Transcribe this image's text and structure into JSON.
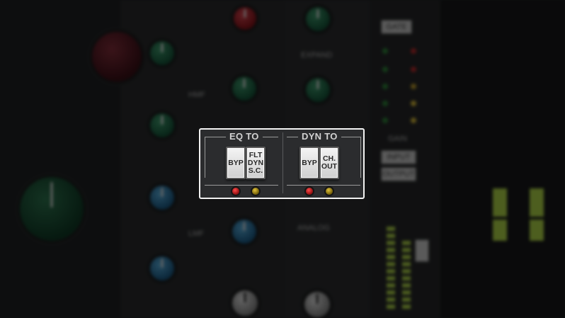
{
  "panel": {
    "eq_to": {
      "title": "EQ TO",
      "buttons": [
        {
          "label": "BYP"
        },
        {
          "lines": [
            "FLT",
            "DYN",
            "S.C."
          ]
        }
      ],
      "leds": [
        "red",
        "yellow"
      ]
    },
    "dyn_to": {
      "title": "DYN TO",
      "buttons": [
        {
          "label": "BYP"
        },
        {
          "lines": [
            "CH.",
            "OUT"
          ]
        }
      ],
      "leds": [
        "red",
        "yellow"
      ]
    }
  },
  "background": {
    "labels": {
      "expand": "EXPAND",
      "hmf": "HMF",
      "lmf": "LMF",
      "gate": "GATE",
      "input": "INPUT",
      "output": "OUTPUT",
      "analog": "ANALOG",
      "gain": "GAIN"
    }
  },
  "colors": {
    "panel_bg": "#2b2c2e",
    "highlight_border": "#f2f2f2",
    "led_red": "#ff4a4a",
    "led_yellow": "#e0c23a",
    "knob_green": "#2f8a5c",
    "knob_blue": "#3a8cc8",
    "knob_red": "#d22a35",
    "meter_green": "#b8e04a"
  }
}
